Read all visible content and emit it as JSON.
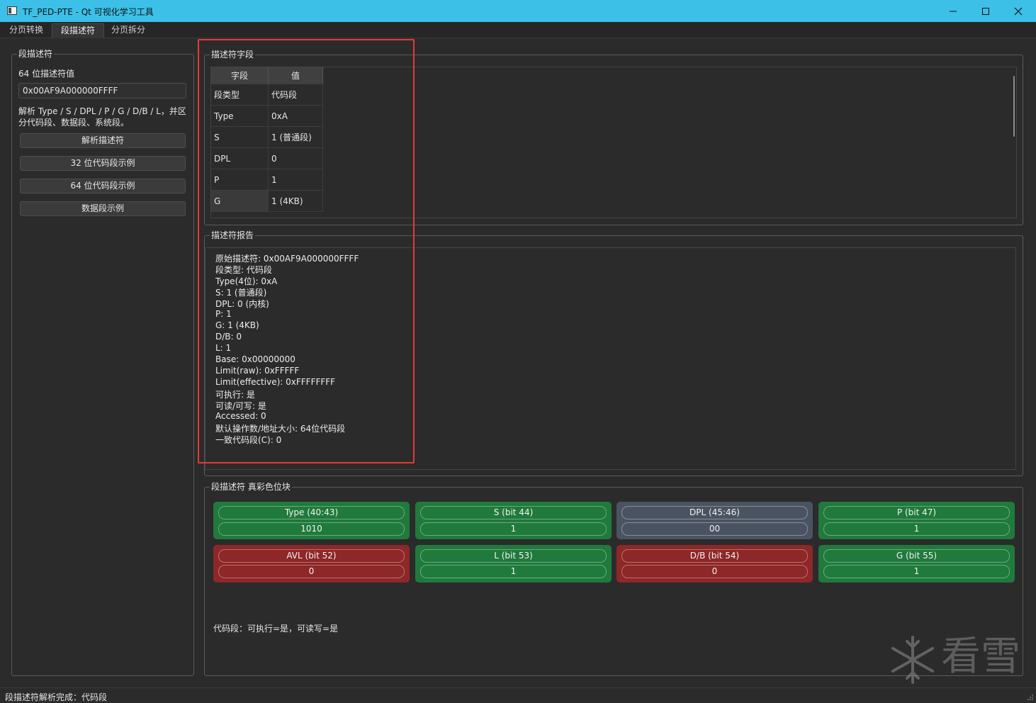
{
  "window": {
    "title": "TF_PED-PTE - Qt 可视化学习工具"
  },
  "tabs": [
    {
      "label": "分页转换"
    },
    {
      "label": "段描述符"
    },
    {
      "label": "分页拆分"
    }
  ],
  "left_panel": {
    "group_title": "段描述符",
    "value_label": "64 位描述符值",
    "value_input": "0x00AF9A000000FFFF",
    "hint_line1": "解析 Type / S / DPL / P / G / D/B / L，并区",
    "hint_line2": "分代码段、数据段、系统段。",
    "buttons": {
      "parse": "解析描述符",
      "code32": "32 位代码段示例",
      "code64": "64 位代码段示例",
      "data": "数据段示例"
    }
  },
  "fields_group": {
    "title": "描述符字段",
    "header_field": "字段",
    "header_value": "值",
    "rows": [
      {
        "field": "段类型",
        "value": "代码段"
      },
      {
        "field": "Type",
        "value": "0xA"
      },
      {
        "field": "S",
        "value": "1 (普通段)"
      },
      {
        "field": "DPL",
        "value": "0"
      },
      {
        "field": "P",
        "value": "1"
      },
      {
        "field": "G",
        "value": "1 (4KB)"
      }
    ]
  },
  "report_group": {
    "title": "描述符报告",
    "lines": [
      "原始描述符: 0x00AF9A000000FFFF",
      "段类型: 代码段",
      "Type(4位): 0xA",
      "S: 1 (普通段)",
      "DPL: 0 (内核)",
      "P: 1",
      "G: 1 (4KB)",
      "D/B: 0",
      "L: 1",
      "Base: 0x00000000",
      "Limit(raw): 0xFFFFF",
      "Limit(effective): 0xFFFFFFFF",
      "可执行: 是",
      "可读/可写: 是",
      "Accessed: 0",
      "默认操作数/地址大小: 64位代码段",
      "一致代码段(C): 0"
    ]
  },
  "bits_group": {
    "title": "段描述符 真彩色位块",
    "cards": [
      {
        "label": "Type (40:43)",
        "value": "1010",
        "color": "#1f7a3c"
      },
      {
        "label": "S (bit 44)",
        "value": "1",
        "color": "#1f7a3c"
      },
      {
        "label": "DPL (45:46)",
        "value": "00",
        "color": "#4a5361"
      },
      {
        "label": "P (bit 47)",
        "value": "1",
        "color": "#1f7a3c"
      },
      {
        "label": "AVL (bit 52)",
        "value": "0",
        "color": "#8e2727"
      },
      {
        "label": "L (bit 53)",
        "value": "1",
        "color": "#1f7a3c"
      },
      {
        "label": "D/B (bit 54)",
        "value": "0",
        "color": "#8e2727"
      },
      {
        "label": "G (bit 55)",
        "value": "1",
        "color": "#1f7a3c"
      }
    ],
    "summary": "代码段：可执行=是，可读写=是"
  },
  "status_bar": {
    "message": "段描述符解析完成：代码段"
  },
  "watermark": {
    "text": "看雪"
  },
  "icons": {
    "app": "app-icon",
    "minimize": "minimize-icon",
    "maximize": "maximize-icon",
    "close": "close-icon",
    "watermark": "snowflake-icon",
    "grip": "size-grip-icon"
  }
}
